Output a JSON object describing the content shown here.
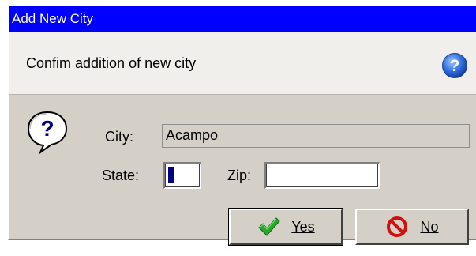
{
  "window": {
    "title": "Add New City"
  },
  "header": {
    "text": "Confim addition of new city",
    "icon": "help-icon"
  },
  "form": {
    "city_label": "City:",
    "city_value": "Acampo",
    "state_label": "State:",
    "state_value": "",
    "zip_label": "Zip:",
    "zip_value": ""
  },
  "buttons": {
    "yes_label": "Yes",
    "no_label": "No"
  },
  "colors": {
    "titlebar": "#0000ff",
    "dialog_bg": "#d4d0c8",
    "header_bg": "#f0efeb"
  }
}
